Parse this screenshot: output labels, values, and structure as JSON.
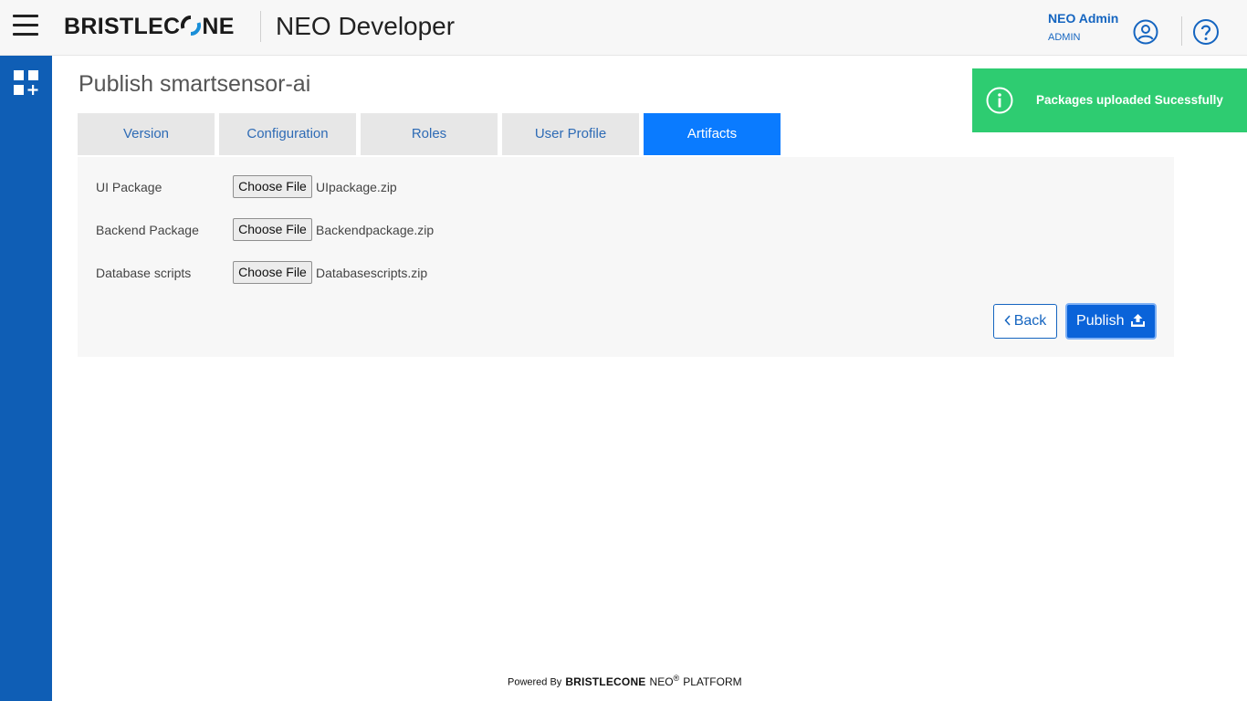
{
  "header": {
    "brand_part1": "BRISTLEC",
    "brand_part2": "NE",
    "app_title": "NEO Developer",
    "user_name": "NEO Admin",
    "user_role": "ADMIN"
  },
  "page": {
    "title": "Publish smartsensor-ai"
  },
  "tabs": [
    {
      "label": "Version",
      "active": false
    },
    {
      "label": "Configuration",
      "active": false
    },
    {
      "label": "Roles",
      "active": false
    },
    {
      "label": "User Profile",
      "active": false
    },
    {
      "label": "Artifacts",
      "active": true
    }
  ],
  "artifacts": [
    {
      "label": "UI Package",
      "button": "Choose File",
      "file": "UIpackage.zip"
    },
    {
      "label": "Backend Package",
      "button": "Choose File",
      "file": "Backendpackage.zip"
    },
    {
      "label": "Database scripts",
      "button": "Choose File",
      "file": "Databasescripts.zip"
    }
  ],
  "actions": {
    "back_label": "Back",
    "publish_label": "Publish"
  },
  "toast": {
    "message": "Packages uploaded Sucessfully"
  },
  "footer": {
    "powered_by": "Powered By",
    "brand": "BRISTLECONE",
    "neo": "NEO",
    "registered": "®",
    "platform": "PLATFORM"
  },
  "colors": {
    "sidebar": "#0f5eb5",
    "active_tab": "#0a7bff",
    "toast": "#2ecc71",
    "link_blue": "#1565c0"
  },
  "icons": {
    "menu": "hamburger-icon",
    "user": "user-circle-icon",
    "help": "help-circle-icon",
    "apps": "apps-add-icon",
    "toast": "info-icon",
    "publish": "upload-icon",
    "back": "chevron-left-icon"
  }
}
